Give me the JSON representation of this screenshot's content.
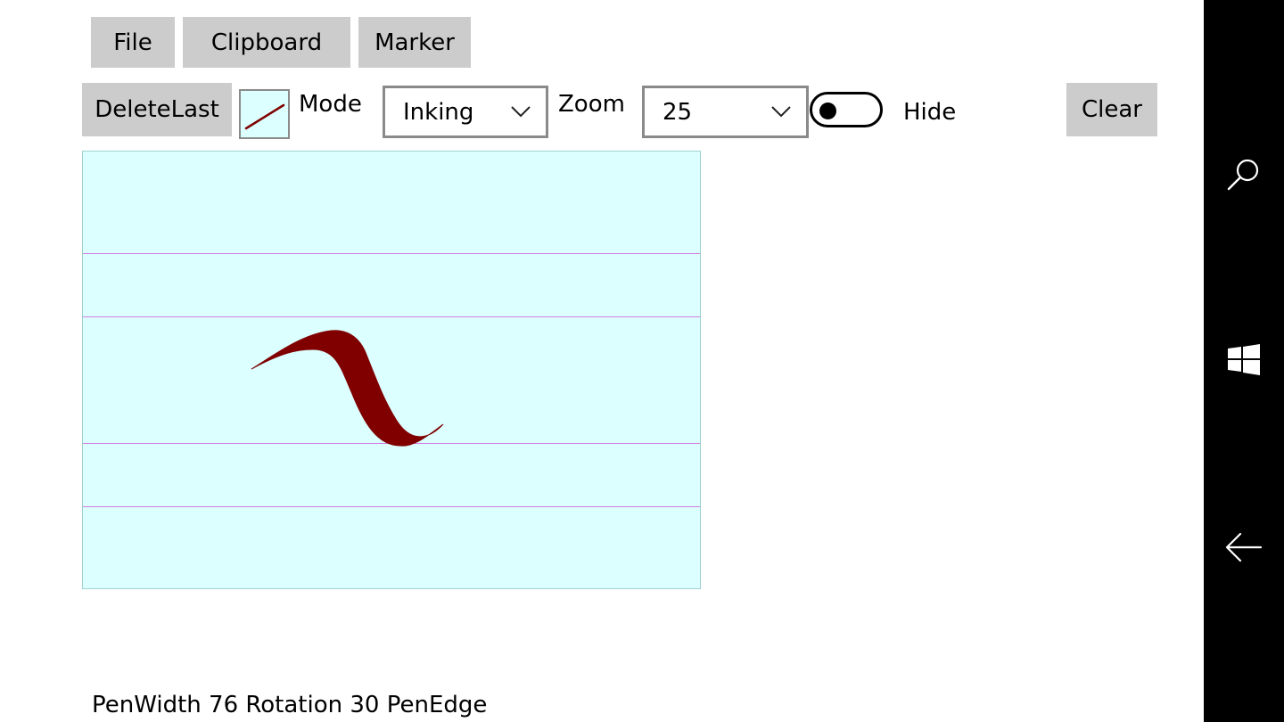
{
  "menu": {
    "file_label": "File",
    "clipboard_label": "Clipboard",
    "marker_label": "Marker"
  },
  "toolbar": {
    "delete_last_label": "DeleteLast",
    "mode_label": "Mode",
    "mode_value": "Inking",
    "zoom_label": "Zoom",
    "zoom_value": "25",
    "hide_label": "Hide",
    "hide_toggle_on": false,
    "clear_label": "Clear",
    "pen_color": "#800000"
  },
  "canvas": {
    "background": "#dcffff",
    "rule_color": "#d27ee0",
    "stroke_color": "#800000"
  },
  "status": {
    "text": "PenWidth 76 Rotation 30 PenEdge"
  },
  "navbar": {
    "icons": [
      "search-icon",
      "windows-icon",
      "back-arrow-icon"
    ]
  }
}
